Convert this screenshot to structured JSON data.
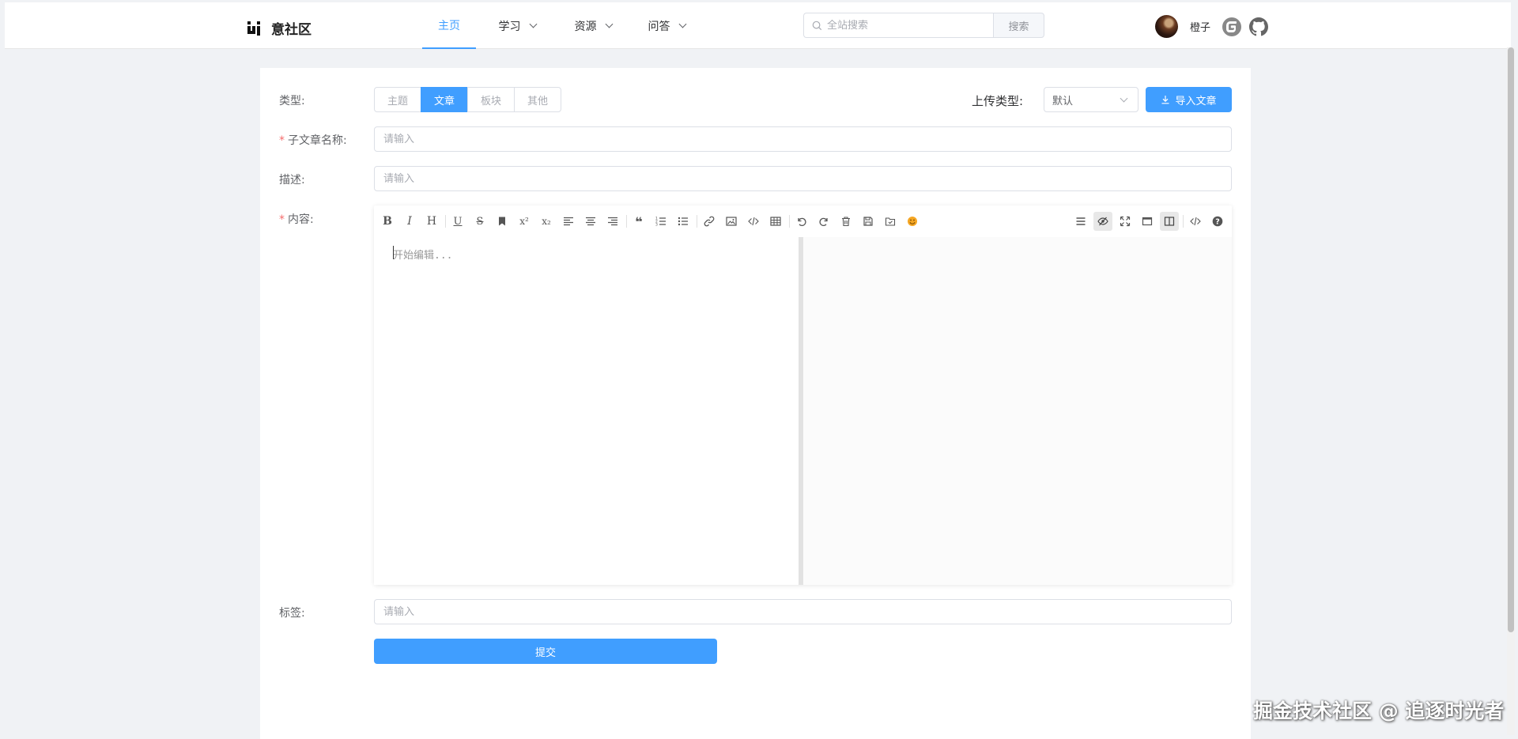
{
  "header": {
    "brand": "意社区",
    "nav": [
      {
        "label": "主页"
      },
      {
        "label": "学习"
      },
      {
        "label": "资源"
      },
      {
        "label": "问答"
      }
    ],
    "search": {
      "placeholder": "全站搜索",
      "button": "搜索"
    },
    "user_name": "橙子"
  },
  "form": {
    "type_label": "类型:",
    "type_options": [
      "主题",
      "文章",
      "板块",
      "其他"
    ],
    "type_selected": "文章",
    "upload_type_label": "上传类型:",
    "upload_type_value": "默认",
    "import_button": "导入文章",
    "title_label": "子文章名称:",
    "title_placeholder": "请输入",
    "desc_label": "描述:",
    "desc_placeholder": "请输入",
    "content_label": "内容:",
    "editor_placeholder": "开始编辑...",
    "tags_label": "标签:",
    "tags_placeholder": "请输入",
    "submit": "提交"
  },
  "colors": {
    "accent": "#409eff",
    "required": "#f56c6c",
    "page_bg": "#f0f2f5"
  },
  "watermark": "掘金技术社区 @ 追逐时光者"
}
